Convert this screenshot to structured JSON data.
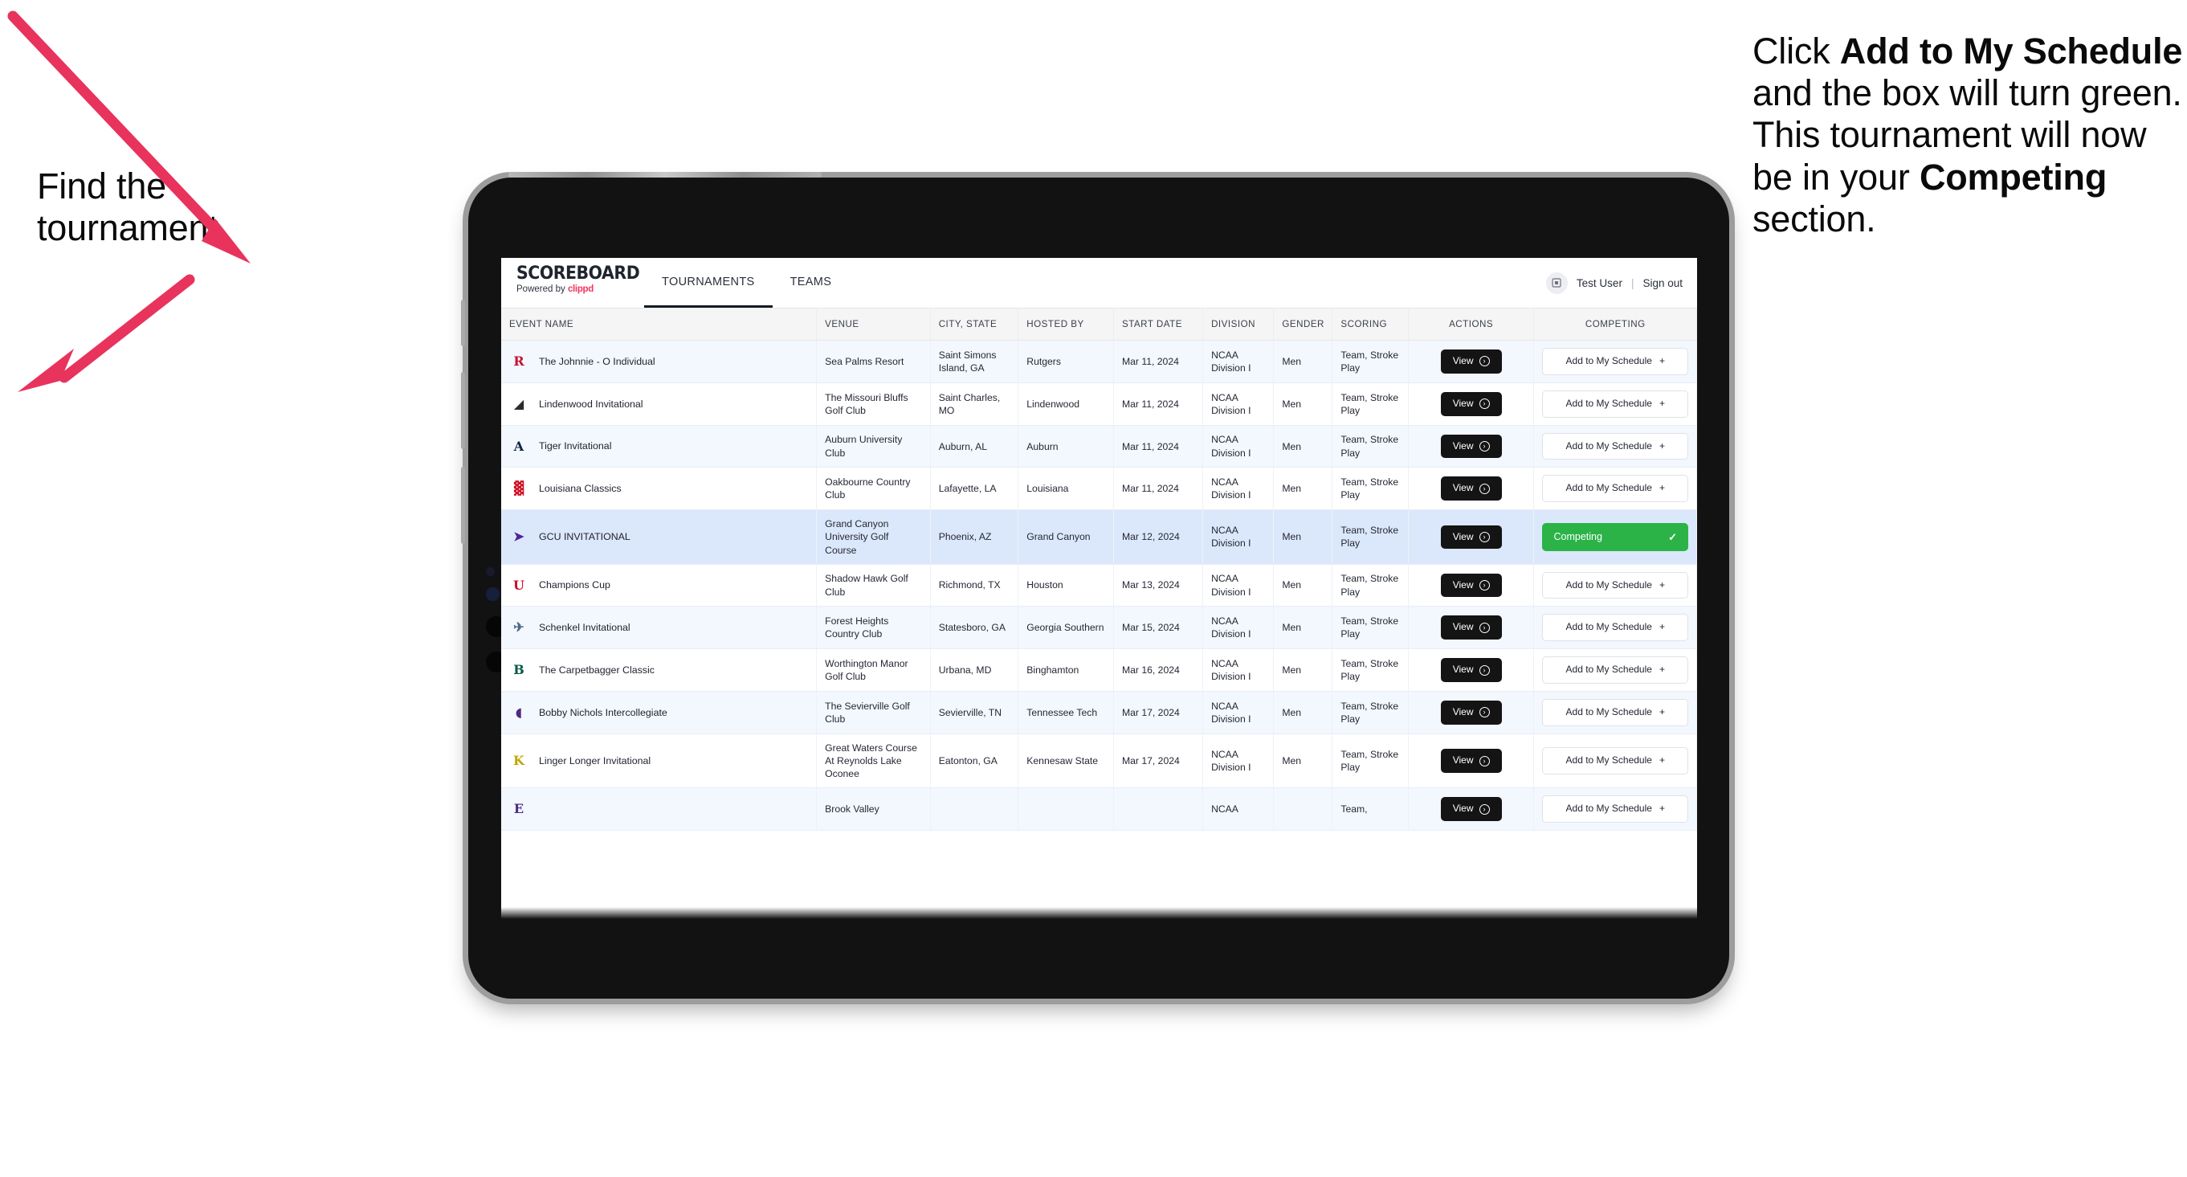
{
  "annotations": {
    "left": {
      "line1": "Find the",
      "line2": "tournament."
    },
    "right": {
      "p1_a": "Click ",
      "p1_b": "Add to My Schedule",
      "p1_c": " and the box will turn green. This tournament will now be in your ",
      "p1_d": "Competing",
      "p1_e": " section."
    },
    "arrow_color": "#e8335c"
  },
  "app": {
    "brand": {
      "title": "SCOREBOARD",
      "powered_prefix": "Powered by ",
      "powered_brand": "clippd"
    },
    "nav": [
      {
        "label": "TOURNAMENTS",
        "active": true
      },
      {
        "label": "TEAMS",
        "active": false
      }
    ],
    "header_right": {
      "avatar_icon": "user-avatar-icon",
      "user": "Test User",
      "separator": "|",
      "signout": "Sign out"
    }
  },
  "table": {
    "columns": [
      "EVENT NAME",
      "VENUE",
      "CITY, STATE",
      "HOSTED BY",
      "START DATE",
      "DIVISION",
      "GENDER",
      "SCORING",
      "ACTIONS",
      "COMPETING"
    ],
    "view_label": "View",
    "add_label": "Add to My Schedule",
    "add_plus": "+",
    "competing_label": "Competing",
    "competing_check": "✓",
    "rows": [
      {
        "logo": "R",
        "logo_color": "#c8102e",
        "logo_bg": "transparent",
        "event": "The Johnnie - O Individual",
        "venue": "Sea Palms Resort",
        "city": "Saint Simons Island, GA",
        "host": "Rutgers",
        "date": "Mar 11, 2024",
        "division": "NCAA Division I",
        "gender": "Men",
        "scoring": "Team, Stroke Play",
        "competing": false
      },
      {
        "logo": "◢",
        "logo_color": "#2b2b2b",
        "logo_bg": "transparent",
        "event": "Lindenwood Invitational",
        "venue": "The Missouri Bluffs Golf Club",
        "city": "Saint Charles, MO",
        "host": "Lindenwood",
        "date": "Mar 11, 2024",
        "division": "NCAA Division I",
        "gender": "Men",
        "scoring": "Team, Stroke Play",
        "competing": false
      },
      {
        "logo": "A",
        "logo_color": "#0c2340",
        "logo_bg": "transparent",
        "event": "Tiger Invitational",
        "venue": "Auburn University Club",
        "city": "Auburn, AL",
        "host": "Auburn",
        "date": "Mar 11, 2024",
        "division": "NCAA Division I",
        "gender": "Men",
        "scoring": "Team, Stroke Play",
        "competing": false
      },
      {
        "logo": "▓",
        "logo_color": "#ce1126",
        "logo_bg": "transparent",
        "event": "Louisiana Classics",
        "venue": "Oakbourne Country Club",
        "city": "Lafayette, LA",
        "host": "Louisiana",
        "date": "Mar 11, 2024",
        "division": "NCAA Division I",
        "gender": "Men",
        "scoring": "Team, Stroke Play",
        "competing": false
      },
      {
        "logo": "➤",
        "logo_color": "#522398",
        "logo_bg": "transparent",
        "event": "GCU INVITATIONAL",
        "venue": "Grand Canyon University Golf Course",
        "city": "Phoenix, AZ",
        "host": "Grand Canyon",
        "date": "Mar 12, 2024",
        "division": "NCAA Division I",
        "gender": "Men",
        "scoring": "Team, Stroke Play",
        "competing": true
      },
      {
        "logo": "U",
        "logo_color": "#c8102e",
        "logo_bg": "transparent",
        "event": "Champions Cup",
        "venue": "Shadow Hawk Golf Club",
        "city": "Richmond, TX",
        "host": "Houston",
        "date": "Mar 13, 2024",
        "division": "NCAA Division I",
        "gender": "Men",
        "scoring": "Team, Stroke Play",
        "competing": false
      },
      {
        "logo": "✈",
        "logo_color": "#4a6b8a",
        "logo_bg": "transparent",
        "event": "Schenkel Invitational",
        "venue": "Forest Heights Country Club",
        "city": "Statesboro, GA",
        "host": "Georgia Southern",
        "date": "Mar 15, 2024",
        "division": "NCAA Division I",
        "gender": "Men",
        "scoring": "Team, Stroke Play",
        "competing": false
      },
      {
        "logo": "B",
        "logo_color": "#005a43",
        "logo_bg": "transparent",
        "event": "The Carpetbagger Classic",
        "venue": "Worthington Manor Golf Club",
        "city": "Urbana, MD",
        "host": "Binghamton",
        "date": "Mar 16, 2024",
        "division": "NCAA Division I",
        "gender": "Men",
        "scoring": "Team, Stroke Play",
        "competing": false
      },
      {
        "logo": "◖",
        "logo_color": "#4e2a84",
        "logo_bg": "transparent",
        "event": "Bobby Nichols Intercollegiate",
        "venue": "The Sevierville Golf Club",
        "city": "Sevierville, TN",
        "host": "Tennessee Tech",
        "date": "Mar 17, 2024",
        "division": "NCAA Division I",
        "gender": "Men",
        "scoring": "Team, Stroke Play",
        "competing": false
      },
      {
        "logo": "K",
        "logo_color": "#bfa800",
        "logo_bg": "transparent",
        "event": "Linger Longer Invitational",
        "venue": "Great Waters Course At Reynolds Lake Oconee",
        "city": "Eatonton, GA",
        "host": "Kennesaw State",
        "date": "Mar 17, 2024",
        "division": "NCAA Division I",
        "gender": "Men",
        "scoring": "Team, Stroke Play",
        "competing": false
      },
      {
        "logo": "E",
        "logo_color": "#4e2a84",
        "logo_bg": "transparent",
        "event": "",
        "venue": "Brook Valley",
        "city": "",
        "host": "",
        "date": "",
        "division": "NCAA",
        "gender": "",
        "scoring": "Team,",
        "competing": false
      }
    ]
  }
}
